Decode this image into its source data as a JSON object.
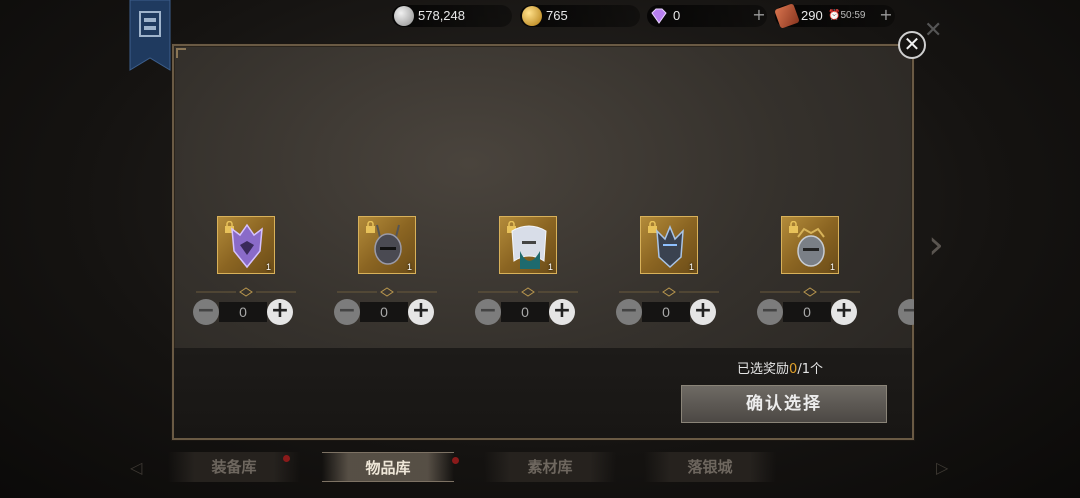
{
  "currencies": [
    {
      "name": "silver",
      "value": "578,248",
      "color": "#c9c9c9"
    },
    {
      "name": "gold",
      "value": "765",
      "color": "#d4a020"
    },
    {
      "name": "diamond",
      "value": "0",
      "color": "#a06ad8"
    },
    {
      "name": "ticket",
      "value": "290",
      "color": "#c0583a"
    }
  ],
  "timer": "50:59",
  "items": [
    {
      "icon": "crystal-helmet-icon",
      "qty": "1",
      "count": "0"
    },
    {
      "icon": "horned-dark-helmet-icon",
      "qty": "1",
      "count": "0"
    },
    {
      "icon": "white-hair-helmet-icon",
      "qty": "1",
      "count": "0"
    },
    {
      "icon": "spiked-blue-helmet-icon",
      "qty": "1",
      "count": "0"
    },
    {
      "icon": "crowned-knight-helmet-icon",
      "qty": "1",
      "count": "0"
    }
  ],
  "selection": {
    "prefix": "已选奖励",
    "current": "0",
    "suffix": "/1个"
  },
  "confirm_label": "确认选择",
  "tabs": [
    "装备库",
    "物品库",
    "素材库",
    "落银城"
  ],
  "active_tab_index": 1,
  "accent_colors": {
    "frame": "#6a5a44",
    "item_gold": "#b38b3a",
    "highlight": "#e0a02a"
  }
}
